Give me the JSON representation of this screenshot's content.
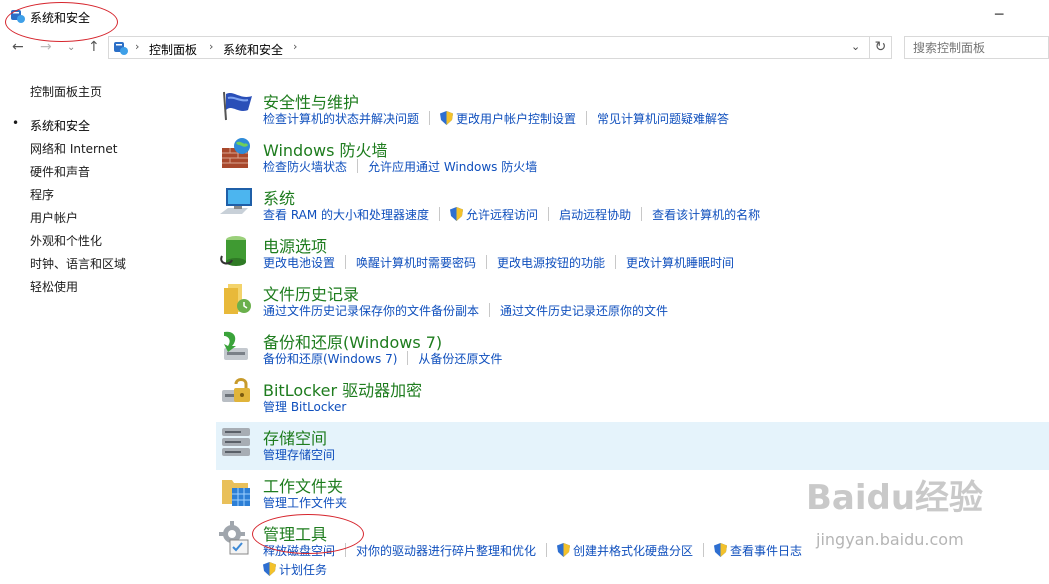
{
  "window": {
    "title": "系统和安全"
  },
  "address": {
    "crumbs": [
      "控制面板",
      "系统和安全"
    ],
    "search_placeholder": "搜索控制面板"
  },
  "leftnav": {
    "items": [
      {
        "label": "控制面板主页"
      },
      {
        "label": "系统和安全",
        "active": true
      },
      {
        "label": "网络和 Internet"
      },
      {
        "label": "硬件和声音"
      },
      {
        "label": "程序"
      },
      {
        "label": "用户帐户"
      },
      {
        "label": "外观和个性化"
      },
      {
        "label": "时钟、语言和区域"
      },
      {
        "label": "轻松使用"
      }
    ]
  },
  "categories": [
    {
      "title": "安全性与维护",
      "icon": "flag-icon",
      "links": [
        {
          "label": "检查计算机的状态并解决问题",
          "shield": false
        },
        {
          "label": "更改用户帐户控制设置",
          "shield": true
        },
        {
          "label": "常见计算机问题疑难解答",
          "shield": false
        }
      ]
    },
    {
      "title": "Windows 防火墙",
      "icon": "firewall-icon",
      "links": [
        {
          "label": "检查防火墙状态",
          "shield": false
        },
        {
          "label": "允许应用通过 Windows 防火墙",
          "shield": false
        }
      ]
    },
    {
      "title": "系统",
      "icon": "computer-icon",
      "links": [
        {
          "label": "查看 RAM 的大小和处理器速度",
          "shield": false
        },
        {
          "label": "允许远程访问",
          "shield": true
        },
        {
          "label": "启动远程协助",
          "shield": false
        },
        {
          "label": "查看该计算机的名称",
          "shield": false
        }
      ]
    },
    {
      "title": "电源选项",
      "icon": "battery-icon",
      "links": [
        {
          "label": "更改电池设置",
          "shield": false
        },
        {
          "label": "唤醒计算机时需要密码",
          "shield": false
        },
        {
          "label": "更改电源按钮的功能",
          "shield": false
        },
        {
          "label": "更改计算机睡眠时间",
          "shield": false
        }
      ]
    },
    {
      "title": "文件历史记录",
      "icon": "file-history-icon",
      "links": [
        {
          "label": "通过文件历史记录保存你的文件备份副本",
          "shield": false
        },
        {
          "label": "通过文件历史记录还原你的文件",
          "shield": false
        }
      ]
    },
    {
      "title": "备份和还原(Windows 7)",
      "icon": "backup-icon",
      "links": [
        {
          "label": "备份和还原(Windows 7)",
          "shield": false
        },
        {
          "label": "从备份还原文件",
          "shield": false
        }
      ]
    },
    {
      "title": "BitLocker 驱动器加密",
      "icon": "bitlocker-icon",
      "links": [
        {
          "label": "管理 BitLocker",
          "shield": false
        }
      ]
    },
    {
      "title": "存储空间",
      "icon": "storage-icon",
      "highlighted": true,
      "links": [
        {
          "label": "管理存储空间",
          "shield": false
        }
      ]
    },
    {
      "title": "工作文件夹",
      "icon": "work-folders-icon",
      "links": [
        {
          "label": "管理工作文件夹",
          "shield": false
        }
      ]
    },
    {
      "title": "管理工具",
      "icon": "admin-tools-icon",
      "links": [
        {
          "label": "释放磁盘空间",
          "shield": false
        },
        {
          "label": "对你的驱动器进行碎片整理和优化",
          "shield": false
        },
        {
          "label": "创建并格式化硬盘分区",
          "shield": true
        },
        {
          "label": "查看事件日志",
          "shield": true
        }
      ],
      "links_row2": [
        {
          "label": "计划任务",
          "shield": true
        }
      ]
    }
  ],
  "watermark": {
    "logo": "Baidu经验",
    "url": "jingyan.baidu.com"
  },
  "colors": {
    "title_green": "#1e7c1e",
    "link_blue": "#0f4fbd",
    "highlight": "#e5f3fb",
    "annotation_red": "#d6262e"
  }
}
